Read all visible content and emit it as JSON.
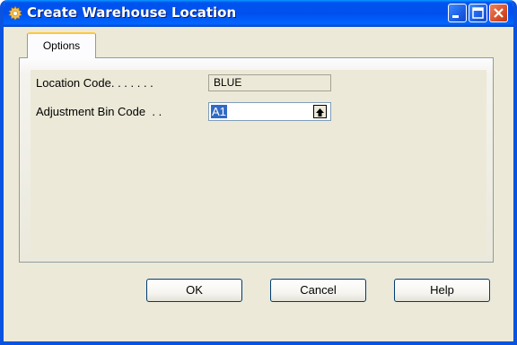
{
  "window": {
    "title": "Create Warehouse Location",
    "title_icon": "gear-icon",
    "controls": [
      "minimize-icon",
      "maximize-icon",
      "close-icon"
    ]
  },
  "tabs": [
    {
      "label": "Options",
      "selected": true
    }
  ],
  "form": {
    "location_code": {
      "label": "Location Code. . . . . . .",
      "value": "BLUE"
    },
    "adjustment_bin_code": {
      "label": "Adjustment Bin Code  . .",
      "value": "A1",
      "lookup_icon": "up-arrow-lookup-icon"
    }
  },
  "buttons": {
    "ok": "OK",
    "cancel": "Cancel",
    "help": "Help"
  },
  "colors": {
    "titlebar": "#0053ee",
    "dialog_bg": "#ece9d8",
    "tab_accent": "#ffc83c",
    "selection": "#316ac5"
  }
}
